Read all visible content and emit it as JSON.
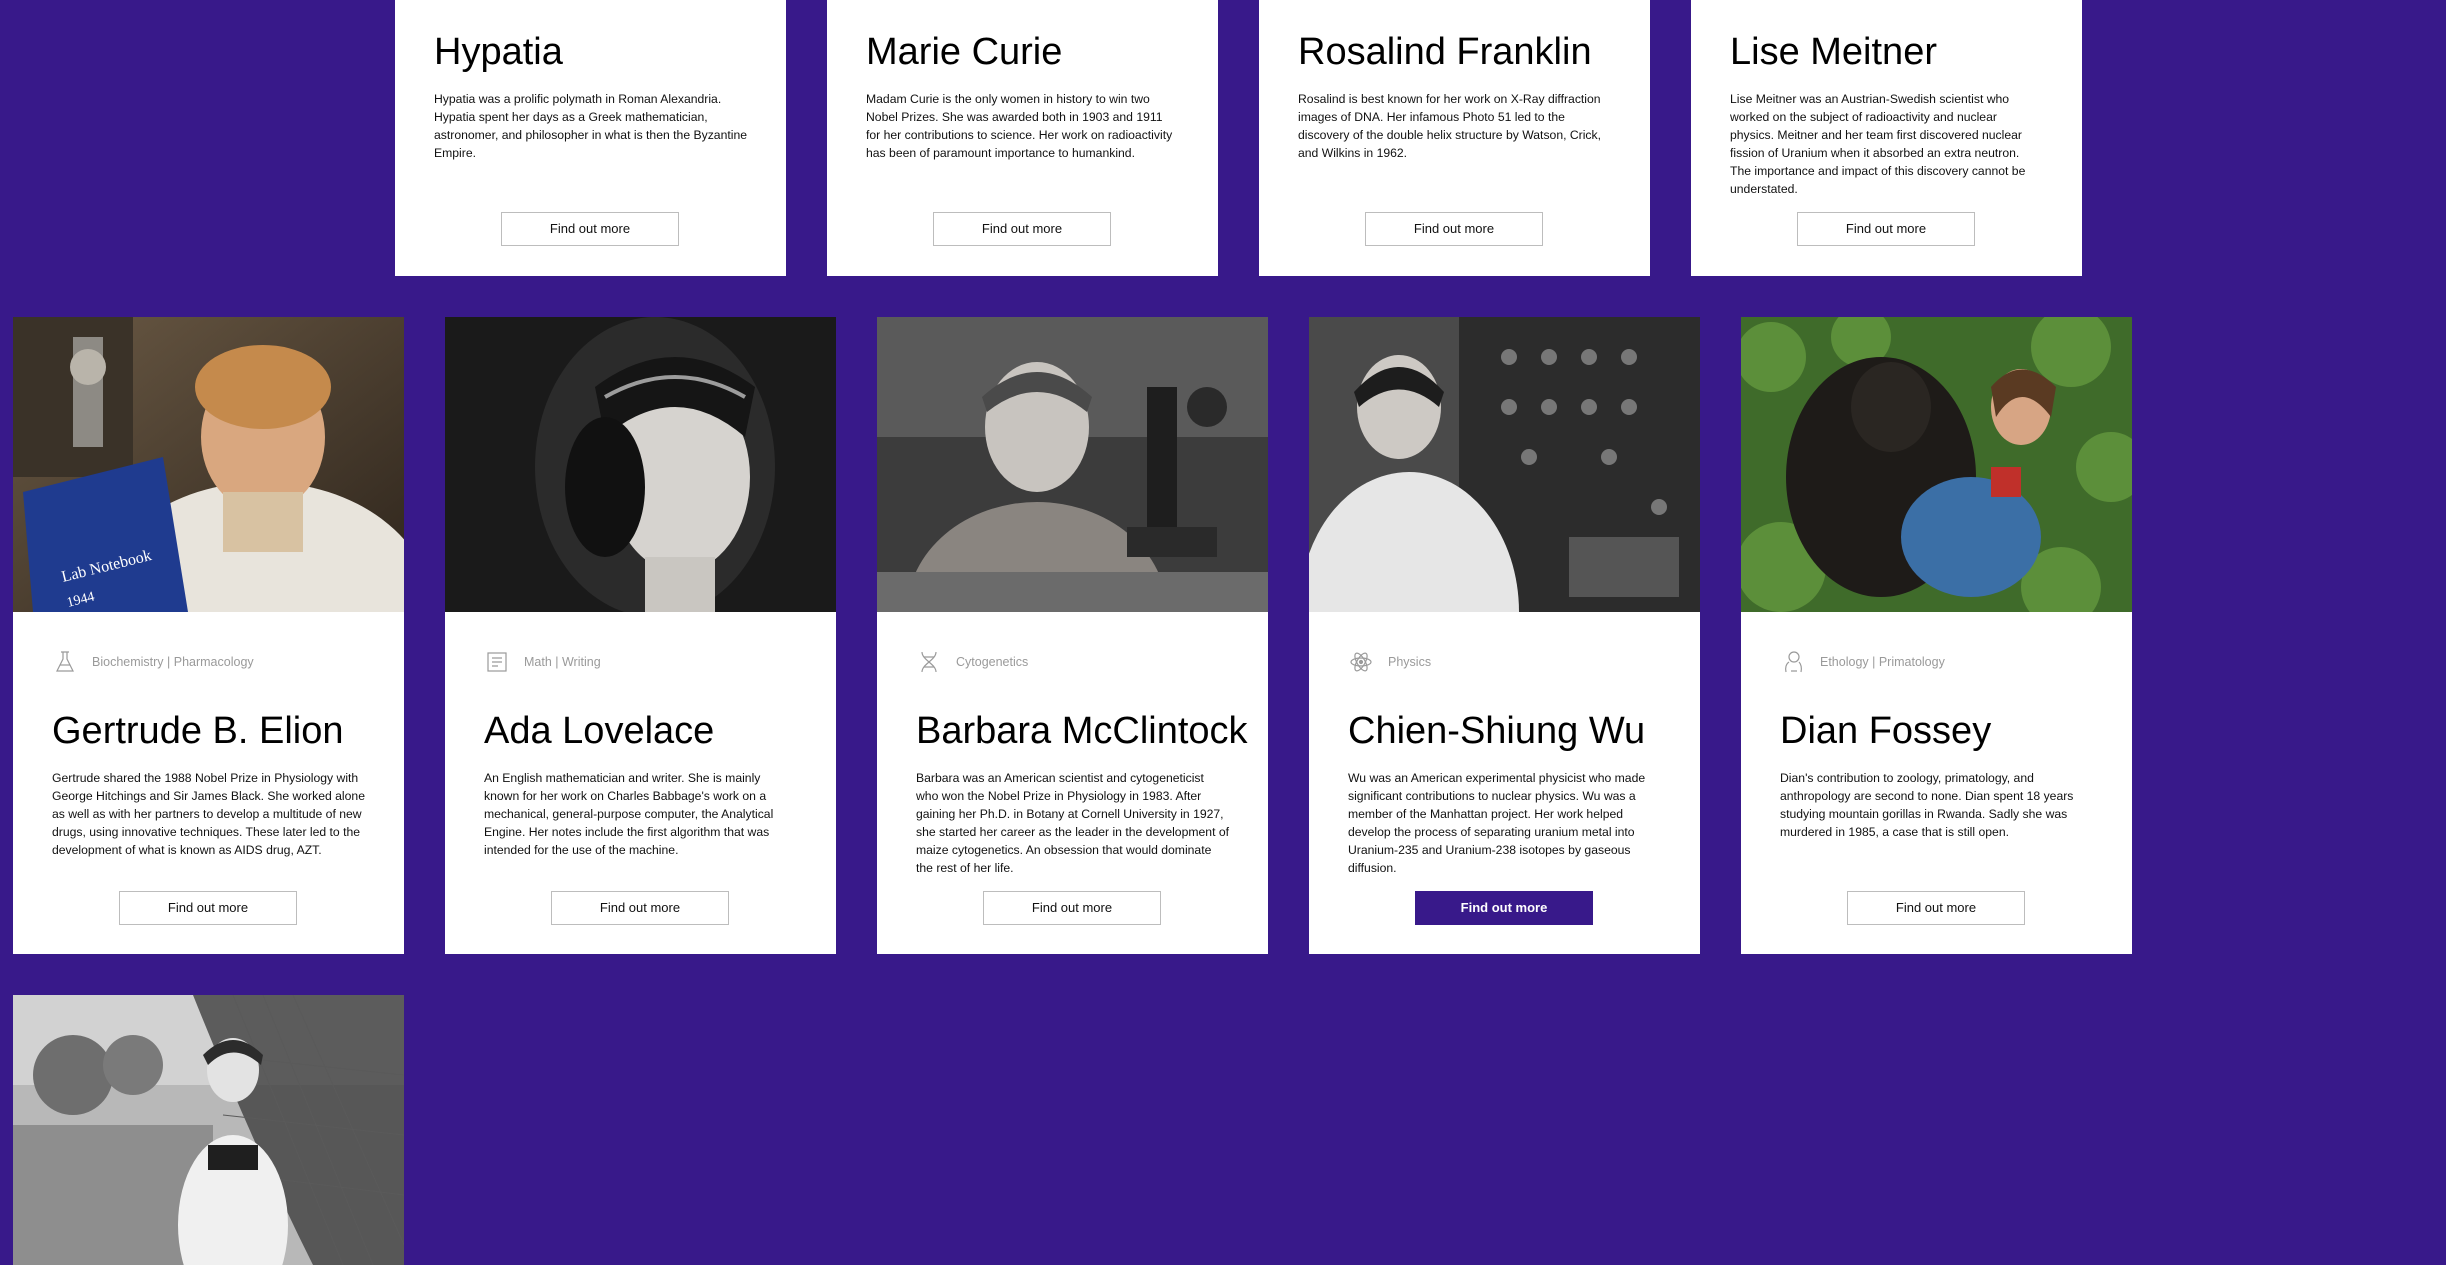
{
  "top_cards": [
    {
      "name": "Hypatia",
      "description": "Hypatia was a prolific polymath in Roman Alexandria. Hypatia spent her days as a Greek mathematician, astronomer, and philosopher in what is then the Byzantine Empire.",
      "button": "Find out more"
    },
    {
      "name": "Marie Curie",
      "description": "Madam Curie is the only women in history to win two Nobel Prizes. She was awarded both in 1903 and 1911 for her contributions to science. Her work on radioactivity has been of paramount importance to humankind.",
      "button": "Find out more"
    },
    {
      "name": "Rosalind Franklin",
      "description": "Rosalind is best known for her work on X-Ray diffraction images of DNA. Her infamous Photo 51 led to the discovery of the double helix structure by Watson, Crick, and Wilkins in 1962.",
      "button": "Find out more"
    },
    {
      "name": "Lise Meitner",
      "description": "Lise Meitner was an Austrian-Swedish scientist who worked on the subject of radioactivity and nuclear physics. Meitner and her team first discovered nuclear fission of Uranium when it absorbed an extra neutron. The importance and impact of this discovery cannot be understated.",
      "button": "Find out more"
    }
  ],
  "mid_cards": [
    {
      "name": "Gertrude B. Elion",
      "field": "Biochemistry | Pharmacology",
      "icon": "flask-icon",
      "photo_text": "Lab Notebook",
      "photo_text2": "1944",
      "description": "Gertrude shared the 1988 Nobel Prize in Physiology with George Hitchings and Sir James Black. She worked alone as well as with her partners to develop a multitude of new drugs, using innovative techniques. These later led to the development of what is known as AIDS drug, AZT.",
      "button": "Find out more"
    },
    {
      "name": "Ada Lovelace",
      "field": "Math | Writing",
      "icon": "book-icon",
      "description": "An English mathematician and writer. She is mainly known for her work on Charles Babbage's work on a mechanical, general-purpose computer, the Analytical Engine. Her notes include the first algorithm that was intended for the use of the machine.",
      "button": "Find out more"
    },
    {
      "name": "Barbara McClintock",
      "field": "Cytogenetics",
      "icon": "dna-icon",
      "description": "Barbara was an American scientist and cytogeneticist who won the Nobel Prize in Physiology in 1983. After gaining her Ph.D. in Botany at Cornell University in 1927, she started her career as the leader in the development of maize cytogenetics. An obsession that would dominate the rest of her life.",
      "button": "Find out more"
    },
    {
      "name": "Chien-Shiung Wu",
      "field": "Physics",
      "icon": "atom-icon",
      "description": "Wu was an American experimental physicist who made significant contributions to nuclear physics. Wu was a member of the Manhattan project. Her work helped develop the process of separating uranium metal into Uranium-235 and Uranium-238 isotopes by gaseous diffusion.",
      "button": "Find out more"
    },
    {
      "name": "Dian Fossey",
      "field": "Ethology | Primatology",
      "icon": "gorilla-icon",
      "description": "Dian's contribution to zoology, primatology, and anthropology are second to none. Dian spent 18 years studying mountain gorillas in Rwanda. Sadly she was murdered in 1985, a case that is still open.",
      "button": "Find out more"
    }
  ],
  "colors": {
    "background": "#38198a",
    "card": "#ffffff",
    "button_active": "#38198a"
  }
}
